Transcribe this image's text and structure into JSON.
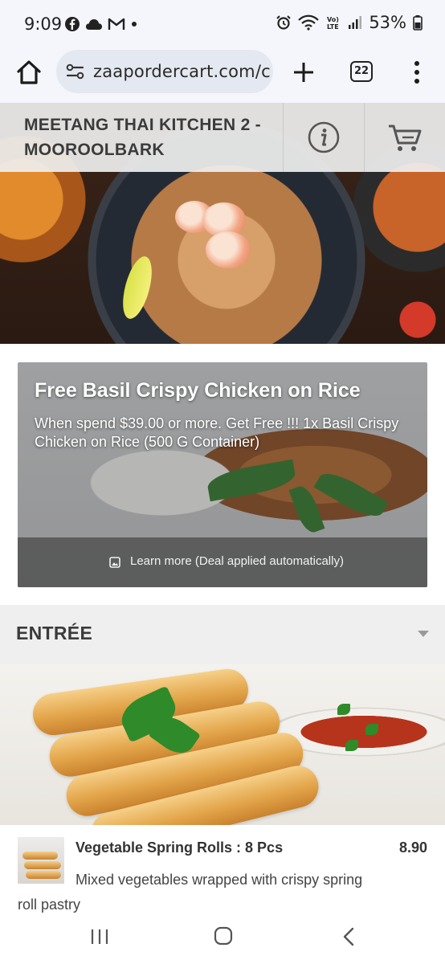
{
  "status_bar": {
    "time": "9:09",
    "left_icons": [
      "facebook-icon",
      "cloud-icon",
      "gmail-icon",
      "dot-icon"
    ],
    "right_icons": [
      "alarm-icon",
      "wifi-icon",
      "volte-icon",
      "signal-icon",
      "battery-icon"
    ],
    "battery_percent": "53%"
  },
  "browser": {
    "url": "zaapordercart.com/c",
    "tab_count": "22"
  },
  "header": {
    "restaurant_name": "MEETANG THAI KITCHEN 2 - MOOROOLBARK"
  },
  "promo": {
    "title": "Free Basil Crispy Chicken on Rice",
    "description": "When spend $39.00 or more. Get Free !!! 1x Basil Crispy Chicken on Rice (500 G Container)",
    "footer_text": "Learn more (Deal applied automatically)"
  },
  "category": {
    "title": "ENTRÉE"
  },
  "menu_items": [
    {
      "name": "Vegetable Spring Rolls : 8 Pcs",
      "price": "8.90",
      "description": "Mixed vegetables wrapped with crispy spring roll pastry"
    }
  ],
  "colors": {
    "status_bg": "#f4f6fb",
    "header_text": "#3b3b3b",
    "category_bg": "#efefef"
  }
}
